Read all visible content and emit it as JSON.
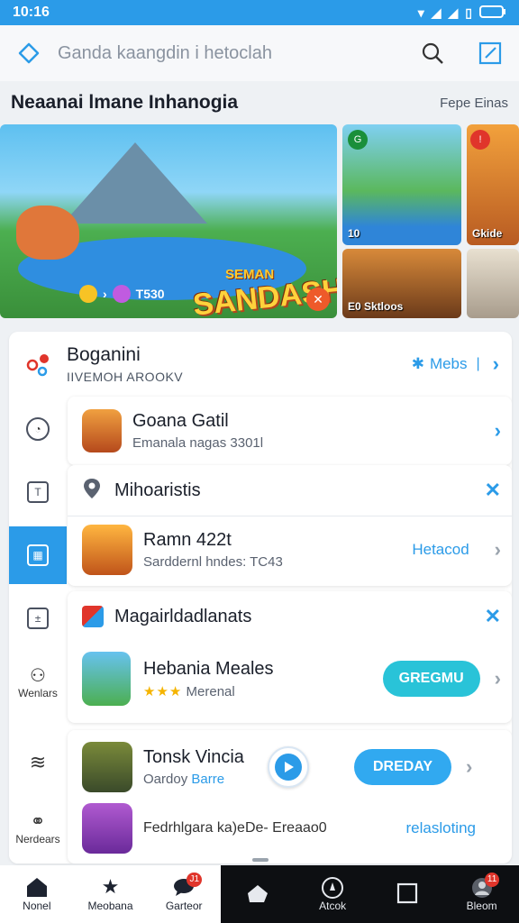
{
  "status": {
    "time": "10:16"
  },
  "topbar": {
    "search_text": "Ganda kaangdin i hetoclah"
  },
  "section": {
    "title": "Neaanai lmane Inhanogia",
    "more": "Fepe Einas"
  },
  "banner": {
    "logo_top": "SEMAN",
    "logo_main": "SANDASH!",
    "stat": "T530"
  },
  "thumbs": [
    {
      "label": "10"
    },
    {
      "label": "Gkide"
    },
    {
      "label": "E0 Sktloos"
    },
    {
      "label": ""
    }
  ],
  "panel": {
    "title": "Boganini",
    "subtitle": "IIVEMOH AROOKV",
    "action": "Mebs",
    "side_items": [
      {
        "label": ""
      },
      {
        "label": ""
      },
      {
        "label": ""
      },
      {
        "label": ""
      },
      {
        "label": "Wenlars"
      },
      {
        "label": ""
      },
      {
        "label": "Nerdears"
      }
    ],
    "card1": {
      "title": "Goana Gatil",
      "sub": "Emanala nagas 3301l"
    },
    "card2": {
      "section": "Mihoaristis",
      "title": "Ramn 422t",
      "sub": "Sarddernl hndes: TC43",
      "link": "Hetacod"
    },
    "card3": {
      "section": "Magairldadlanats",
      "title": "Hebania Meales",
      "stars": "★★★",
      "meta": "Merenal",
      "button": "GREGMU"
    },
    "card4": {
      "title": "Tonsk Vincia",
      "sub_prefix": "Oardoy",
      "sub_accent": "Barre",
      "button": "DREDAY"
    },
    "card5": {
      "title": "Fedrhlgara ka)eDe- Ereaao0",
      "link": "relasloting"
    }
  },
  "bottom_nav": {
    "left": [
      {
        "label": "Nonel",
        "icon": "home-icon"
      },
      {
        "label": "Meobana",
        "icon": "star-icon"
      },
      {
        "label": "Garteor",
        "icon": "chat-icon",
        "badge": "J1"
      }
    ],
    "right": [
      {
        "label": "",
        "icon": "home-outline-icon"
      },
      {
        "label": "Atcok",
        "icon": "compass-icon"
      },
      {
        "label": "",
        "icon": "square-icon"
      },
      {
        "label": "Bleom",
        "icon": "avatar-icon",
        "badge": "11"
      }
    ]
  },
  "colors": {
    "accent": "#2b9be8",
    "teal": "#29c3d8",
    "badge": "#e0352b"
  }
}
